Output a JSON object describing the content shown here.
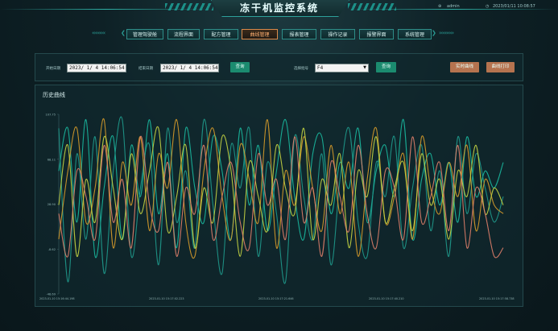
{
  "header": {
    "title": "冻干机监控系统",
    "user": "admin",
    "datetime": "2023/01/11 10:08:57"
  },
  "nav": {
    "items": [
      {
        "label": "管理驾驶舱",
        "active": false
      },
      {
        "label": "流程界面",
        "active": false
      },
      {
        "label": "配方管理",
        "active": false
      },
      {
        "label": "曲线管理",
        "active": true
      },
      {
        "label": "报表管理",
        "active": false
      },
      {
        "label": "操作记录",
        "active": false
      },
      {
        "label": "报警界面",
        "active": false
      },
      {
        "label": "系统管理",
        "active": false
      }
    ]
  },
  "filters": {
    "start_label": "开始日期",
    "start_value": "2023/ 1/ 4 14:06:54",
    "end_label": "结束日期",
    "end_value": "2023/ 1/ 4 14:06:54",
    "query_label": "查询",
    "device_label": "选择批号",
    "device_value": "F4",
    "query2_label": "查询",
    "realtime_label": "实时曲线",
    "print_label": "曲线打印"
  },
  "chart_title": "历史曲线",
  "colors": {
    "accent": "#1b8b6f",
    "orange": "#b5734f",
    "teal": "#2ea19a"
  },
  "chart_data": {
    "type": "line",
    "title": "历史曲线",
    "ylim": [
      -48.69,
      107.75
    ],
    "y_ticks": [
      "107.75",
      "68.11",
      "28.90",
      "-8.62",
      "-48.69"
    ],
    "x_ticks": [
      "2023-01-10 15:16:44.198",
      "2023-01-10 15:17:02.223",
      "2023-01-10 15:17:21.646",
      "2023-01-10 15:17:40.210",
      "2023-01-10 15:17:58.738"
    ],
    "series": [
      {
        "color": "#1ab89f",
        "values": [
          70,
          95,
          40,
          100,
          20,
          60,
          90,
          30,
          85,
          55,
          100,
          45,
          80,
          25,
          95,
          60,
          40,
          90,
          70,
          30,
          95,
          50,
          85,
          35,
          70,
          100,
          55,
          30,
          80,
          90,
          45,
          75,
          60,
          95,
          40,
          70,
          85,
          55,
          100,
          30,
          65,
          80,
          50,
          75,
          40,
          90,
          55,
          70,
          60,
          75
        ]
      },
      {
        "color": "#1f9a8c",
        "values": [
          95,
          5,
          80,
          30,
          90,
          10,
          70,
          100,
          20,
          60,
          85,
          15,
          95,
          40,
          70,
          25,
          100,
          50,
          10,
          85,
          60,
          95,
          20,
          75,
          45,
          5,
          90,
          55,
          30,
          80,
          15,
          65,
          95,
          40,
          20,
          75,
          55,
          90,
          25,
          60,
          85,
          35,
          70,
          20,
          90,
          45,
          80,
          60,
          40,
          55
        ]
      },
      {
        "color": "#d69b2a",
        "values": [
          30,
          70,
          95,
          40,
          60,
          100,
          25,
          75,
          50,
          90,
          35,
          80,
          60,
          100,
          40,
          20,
          70,
          95,
          55,
          30,
          85,
          65,
          40,
          100,
          25,
          70,
          50,
          90,
          60,
          35,
          85,
          45,
          75,
          20,
          65,
          95,
          40,
          55,
          80,
          30,
          90,
          60,
          45,
          75,
          55,
          85,
          35,
          65,
          50,
          45
        ]
      },
      {
        "color": "#c4d442",
        "values": [
          50,
          85,
          20,
          65,
          40,
          90,
          60,
          30,
          80,
          45,
          70,
          95,
          35,
          55,
          85,
          25,
          60,
          40,
          90,
          70,
          20,
          75,
          55,
          35,
          85,
          60,
          45,
          95,
          30,
          65,
          50,
          80,
          25,
          70,
          55,
          90,
          40,
          60,
          75,
          35,
          80,
          50,
          65,
          30,
          70,
          55,
          85,
          45,
          60,
          50
        ]
      },
      {
        "color": "#e07f6a",
        "values": [
          45,
          20,
          70,
          55,
          30,
          85,
          40,
          65,
          25,
          90,
          50,
          35,
          75,
          20,
          60,
          45,
          85,
          30,
          55,
          75,
          40,
          25,
          80,
          50,
          65,
          30,
          90,
          40,
          60,
          20,
          75,
          55,
          35,
          85,
          45,
          25,
          70,
          60,
          30,
          90,
          40,
          55,
          75,
          35,
          85,
          25,
          60,
          45,
          20,
          25
        ]
      }
    ]
  }
}
